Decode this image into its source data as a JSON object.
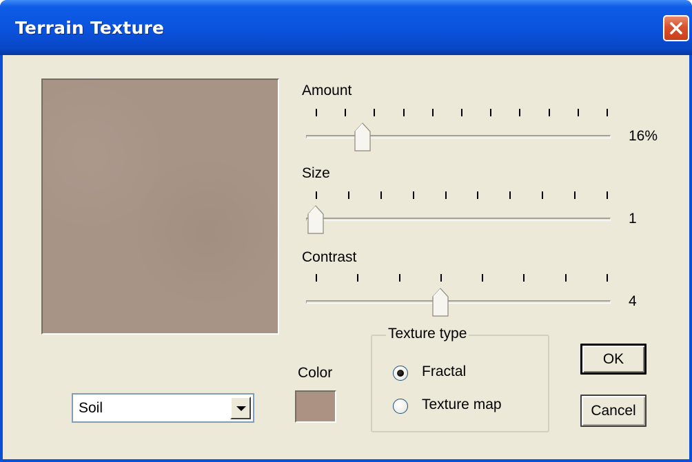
{
  "window": {
    "title": "Terrain Texture"
  },
  "sliders": [
    {
      "label": "Amount",
      "value_text": "16%",
      "position": 0.16,
      "ticks": 11
    },
    {
      "label": "Size",
      "value_text": "1",
      "position": 0.0,
      "ticks": 10
    },
    {
      "label": "Contrast",
      "value_text": "4",
      "position": 0.429,
      "ticks": 8
    }
  ],
  "preview": {
    "color": "#a89487"
  },
  "material_select": {
    "value": "Soil"
  },
  "color_picker": {
    "label": "Color",
    "value": "#ab9283"
  },
  "texture_type": {
    "legend": "Texture type",
    "options": [
      {
        "label": "Fractal",
        "selected": true
      },
      {
        "label": "Texture map",
        "selected": false
      }
    ]
  },
  "buttons": {
    "ok": "OK",
    "cancel": "Cancel"
  }
}
